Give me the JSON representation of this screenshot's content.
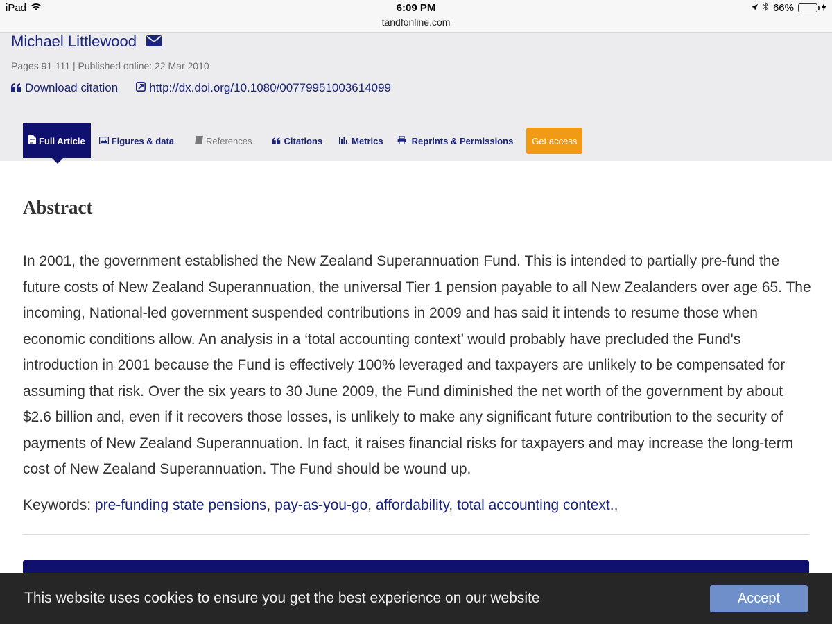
{
  "status_bar": {
    "device": "iPad",
    "time": "6:09 PM",
    "url": "tandfonline.com",
    "battery": "66%",
    "battery_level": 0.66,
    "icons": [
      "wifi-icon",
      "location-icon",
      "bluetooth-icon",
      "battery-icon",
      "charging-icon"
    ]
  },
  "header": {
    "author": "Michael Littlewood",
    "pages": "Pages 91-111 | Published online: 22 Mar 2010",
    "download_citation": "Download citation",
    "doi": "http://dx.doi.org/10.1080/00779951003614099"
  },
  "tabs": {
    "full_article": "Full Article",
    "figures": "Figures & data",
    "references": "References",
    "citations": "Citations",
    "metrics": "Metrics",
    "reprints": "Reprints & Permissions",
    "get_access": "Get access"
  },
  "abstract": {
    "title": "Abstract",
    "body": "In 2001, the government established the New Zealand Superannuation Fund. This is intended to partially pre-fund the future costs of New Zealand Superannuation, the universal Tier 1 pension payable to all New Zealanders over age 65. The incoming, National-led government suspended contributions in 2009 and has said it intends to resume those when economic conditions allow. An analysis in a ‘total accounting context’ would probably have precluded the Fund's introduction in 2001 because the Fund is effectively 100% leveraged and taxpayers are unlikely to be compensated for assuming that risk. Over the six years to 30 June 2009, the Fund diminished the net worth of the government by about $2.6 billion and, even if it recovers those losses, is unlikely to make any significant future contribution to the security of payments of New Zealand Superannuation. In fact, it raises financial risks for taxpayers and may increase the long-term cost of New Zealand Superannuation. The Fund should be wound up."
  },
  "keywords": {
    "label": "Keywords:",
    "items": [
      "pre-funding state pensions",
      "pay-as-you-go",
      "affordability",
      "total accounting context."
    ]
  },
  "cookie": {
    "text": "This website uses cookies to ensure you get the best experience on our website",
    "accept": "Accept"
  },
  "colors": {
    "brand_navy": "#10106e",
    "link_blue": "#1a237e",
    "get_access": "#f19a16",
    "accept_button": "#6e8fc9"
  }
}
